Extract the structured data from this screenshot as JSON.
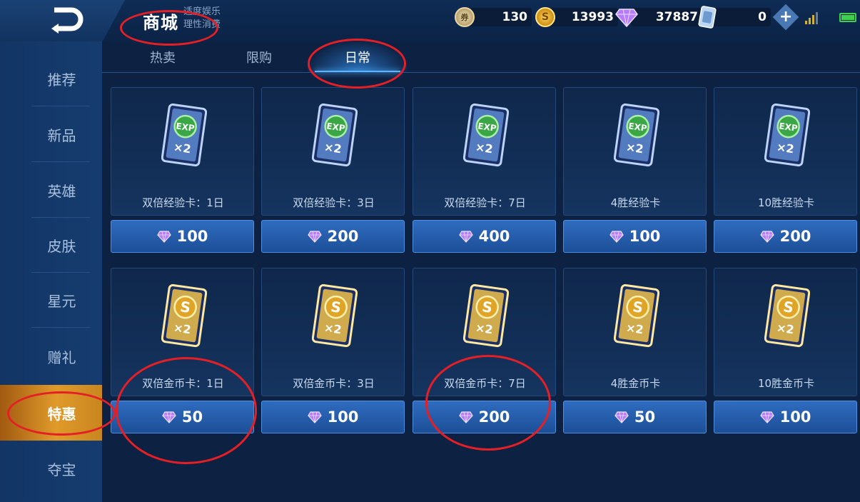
{
  "header": {
    "title": "商城",
    "subtitle_line1": "适度娱乐",
    "subtitle_line2": "理性消费",
    "currencies": [
      {
        "icon": "voucher-icon",
        "value": "130"
      },
      {
        "icon": "gold-coin-icon",
        "value": "13993"
      },
      {
        "icon": "diamond-icon",
        "value": "37887"
      },
      {
        "icon": "card-ticket-icon",
        "value": "0"
      }
    ]
  },
  "sidebar": {
    "items": [
      {
        "label": "推荐"
      },
      {
        "label": "新品"
      },
      {
        "label": "英雄"
      },
      {
        "label": "皮肤"
      },
      {
        "label": "星元"
      },
      {
        "label": "赠礼"
      },
      {
        "label": "特惠",
        "active": true
      },
      {
        "label": "夺宝"
      }
    ]
  },
  "tabs": [
    {
      "label": "热卖"
    },
    {
      "label": "限购"
    },
    {
      "label": "日常",
      "active": true
    }
  ],
  "products": [
    {
      "name": "双倍经验卡：1日",
      "price": "100",
      "kind": "exp",
      "card_text": "EXP",
      "multiplier": "×2"
    },
    {
      "name": "双倍经验卡：3日",
      "price": "200",
      "kind": "exp",
      "card_text": "EXP",
      "multiplier": "×2"
    },
    {
      "name": "双倍经验卡：7日",
      "price": "400",
      "kind": "exp",
      "card_text": "EXP",
      "multiplier": "×2"
    },
    {
      "name": "4胜经验卡",
      "price": "100",
      "kind": "exp",
      "card_text": "EXP",
      "multiplier": "×2"
    },
    {
      "name": "10胜经验卡",
      "price": "200",
      "kind": "exp",
      "card_text": "EXP",
      "multiplier": "×2"
    },
    {
      "name": "双倍金币卡：1日",
      "price": "50",
      "kind": "gold",
      "card_text": "S",
      "multiplier": "×2"
    },
    {
      "name": "双倍金币卡：3日",
      "price": "100",
      "kind": "gold",
      "card_text": "S",
      "multiplier": "×2"
    },
    {
      "name": "双倍金币卡：7日",
      "price": "200",
      "kind": "gold",
      "card_text": "S",
      "multiplier": "×2"
    },
    {
      "name": "4胜金币卡",
      "price": "50",
      "kind": "gold",
      "card_text": "S",
      "multiplier": "×2"
    },
    {
      "name": "10胜金币卡",
      "price": "100",
      "kind": "gold",
      "card_text": "S",
      "multiplier": "×2"
    }
  ],
  "colors": {
    "annotation": "#e51f26",
    "accent_blue": "#59b6ff",
    "active_orange": "#e09a2a"
  }
}
